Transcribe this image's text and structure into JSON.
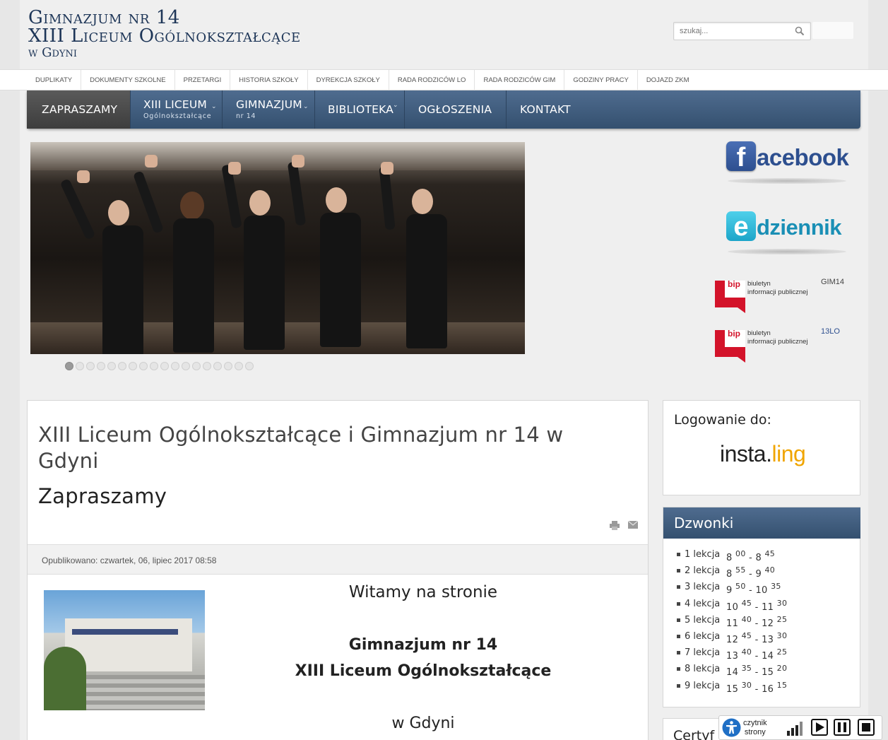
{
  "header": {
    "title_line1": "Gimnazjum nr 14",
    "title_line2": "XIII Liceum Ogólnokształcące",
    "title_line3": "w Gdyni",
    "search_placeholder": "szukaj..."
  },
  "top_links": [
    "DUPLIKATY",
    "DOKUMENTY SZKOLNE",
    "PRZETARGI",
    "HISTORIA SZKOŁY",
    "DYREKCJA SZKOŁY",
    "RADA RODZICÓW LO",
    "RADA RODZICÓW GIM",
    "GODZINY PRACY",
    "DOJAZD ZKM"
  ],
  "main_nav": {
    "items": [
      {
        "label": "ZAPRASZAMY",
        "sub": ""
      },
      {
        "label": "XIII LICEUM",
        "sub": "Ogólnokształcące"
      },
      {
        "label": "GIMNAZJUM",
        "sub": "nr 14"
      },
      {
        "label": "BIBLIOTEKA",
        "sub": ""
      },
      {
        "label": "OGŁOSZENIA",
        "sub": ""
      },
      {
        "label": "KONTAKT",
        "sub": ""
      }
    ]
  },
  "slider": {
    "slide_count": 18,
    "active_index": 0
  },
  "sidebar_links": {
    "facebook": {
      "letter": "f",
      "text": "acebook",
      "color": "#2d4f8f"
    },
    "edziennik": {
      "letter": "e",
      "text": "dziennik",
      "color": "#1a8fb5"
    },
    "bip1": {
      "word": "bip",
      "line1": "biuletyn",
      "line2": "informacji publicznej",
      "code": "GIM14"
    },
    "bip2": {
      "word": "bip",
      "line1": "biuletyn",
      "line2": "informacji publicznej",
      "code": "13LO"
    }
  },
  "article": {
    "title": "XIII Liceum Ogólnokształcące i Gimnazjum nr 14 w Gdyni",
    "subtitle": "Zapraszamy",
    "icons": [
      "print-icon",
      "email-icon"
    ],
    "published": "Opublikowano: czwartek, 06, lipiec 2017 08:58",
    "welcome_line1": "Witamy na stronie",
    "welcome_line2": "Gimnazjum nr 14",
    "welcome_line3": "XIII Liceum Ogólnokształcące",
    "welcome_line4": "w Gdyni"
  },
  "login_widget": {
    "title": "Logowanie do:",
    "brand_a": "insta.",
    "brand_b": "ling"
  },
  "bells_widget": {
    "title": "Dzwonki",
    "rows": [
      {
        "n": "1 lekcja",
        "sh": "8",
        "sm": "00",
        "eh": "8",
        "em": "45"
      },
      {
        "n": "2 lekcja",
        "sh": "8",
        "sm": "55",
        "eh": "9",
        "em": "40"
      },
      {
        "n": "3 lekcja",
        "sh": "9",
        "sm": "50",
        "eh": "10",
        "em": "35"
      },
      {
        "n": "4 lekcja",
        "sh": "10",
        "sm": "45",
        "eh": "11",
        "em": "30"
      },
      {
        "n": "5 lekcja",
        "sh": "11",
        "sm": "40",
        "eh": "12",
        "em": "25"
      },
      {
        "n": "6 lekcja",
        "sh": "12",
        "sm": "45",
        "eh": "13",
        "em": "30"
      },
      {
        "n": "7 lekcja",
        "sh": "13",
        "sm": "40",
        "eh": "14",
        "em": "25"
      },
      {
        "n": "8 lekcja",
        "sh": "14",
        "sm": "35",
        "eh": "15",
        "em": "20"
      },
      {
        "n": "9 lekcja",
        "sh": "15",
        "sm": "30",
        "eh": "16",
        "em": "15"
      }
    ]
  },
  "cert_widget": {
    "title": "Certyf"
  },
  "reader": {
    "line1": "czytnik",
    "line2": "strony"
  }
}
